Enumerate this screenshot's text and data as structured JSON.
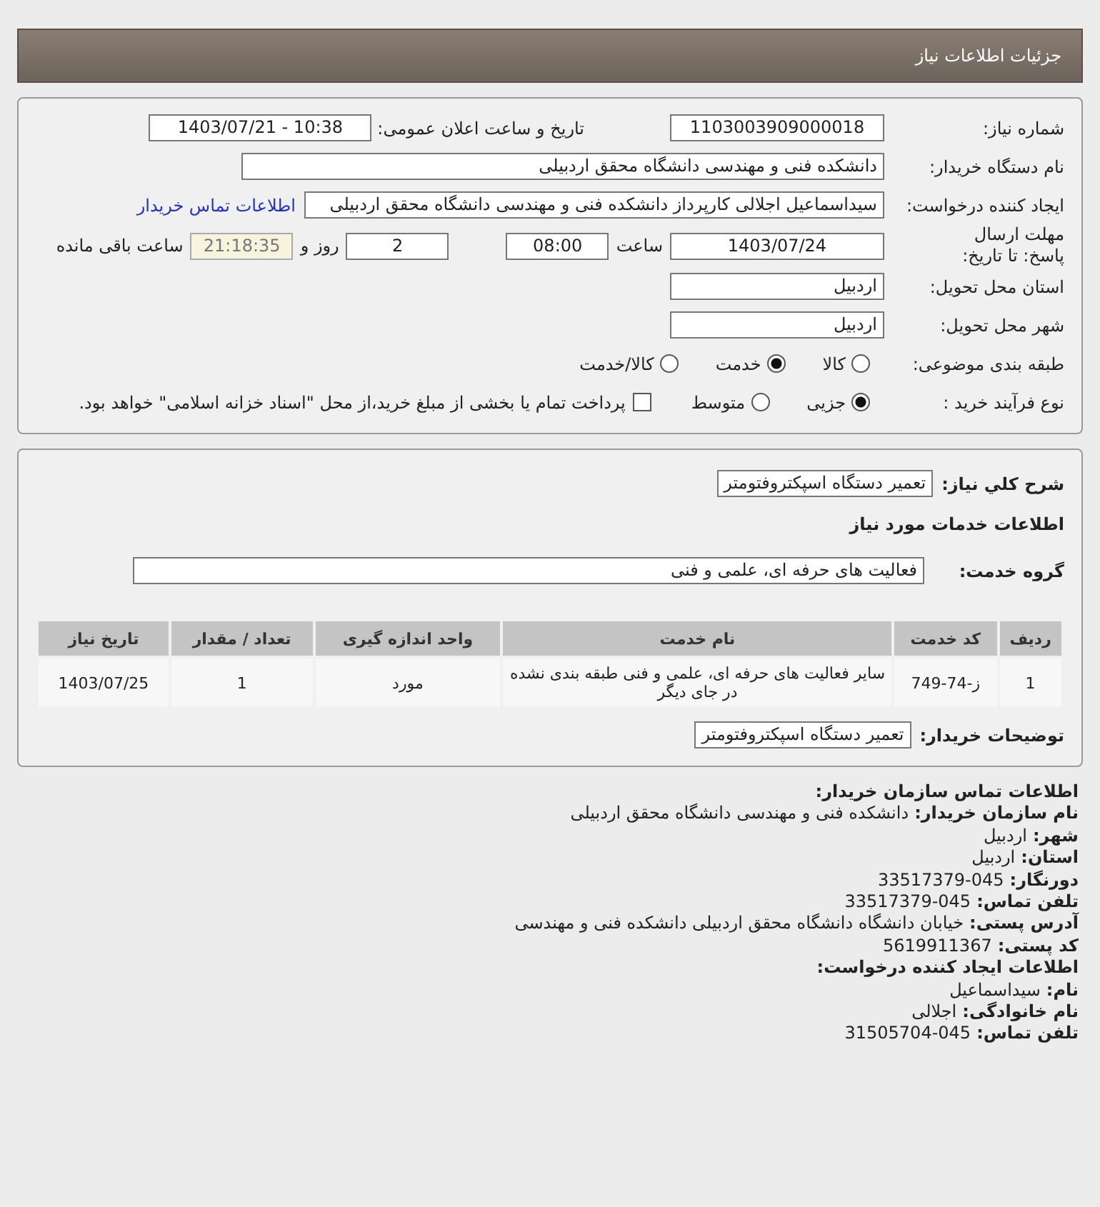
{
  "page": {
    "title": "جزئیات اطلاعات نیاز"
  },
  "details": {
    "need_number": {
      "label": "شماره نیاز:",
      "value": "1103003909000018"
    },
    "announce": {
      "label": "تاریخ و ساعت اعلان عمومی:",
      "value": "1403/07/21 - 10:38"
    },
    "buyer": {
      "label": "نام دستگاه خریدار:",
      "value": "دانشکده فنی و مهندسی دانشگاه محقق اردبیلی"
    },
    "creator": {
      "label": "ایجاد کننده درخواست:",
      "value": "سیداسماعیل اجلالی کارپرداز دانشکده فنی و مهندسی دانشگاه محقق اردبیلی",
      "link": "اطلاعات تماس خریدار"
    },
    "deadline": {
      "label": "مهلت ارسال پاسخ: تا تاریخ:",
      "date": "1403/07/24",
      "time_label": "ساعت",
      "time": "08:00",
      "days": "2",
      "days_label": "روز و",
      "remaining": "21:18:35",
      "remaining_label": "ساعت باقی مانده"
    },
    "province": {
      "label": "استان محل تحویل:",
      "value": "اردبیل"
    },
    "city": {
      "label": "شهر محل تحویل:",
      "value": "اردبیل"
    },
    "category": {
      "label": "طبقه بندی موضوعی:",
      "options": [
        {
          "label": "کالا",
          "selected": false
        },
        {
          "label": "خدمت",
          "selected": true
        },
        {
          "label": "کالا/خدمت",
          "selected": false
        }
      ]
    },
    "process": {
      "label": "نوع فرآیند خرید :",
      "options": [
        {
          "label": "جزیی",
          "selected": true
        },
        {
          "label": "متوسط",
          "selected": false
        }
      ],
      "payment": {
        "checked": false,
        "label": "پرداخت تمام یا بخشی از مبلغ خرید،از محل \"اسناد خزانه اسلامی\" خواهد بود."
      }
    }
  },
  "need": {
    "summary_label": "شرح کلي نیاز:",
    "summary": "تعمیر دستگاه اسپکتروفتومتر",
    "services_heading": "اطلاعات خدمات مورد نیاز",
    "group_label": "گروه خدمت:",
    "group": "فعالیت های حرفه ای، علمی و فنی",
    "table": {
      "columns": [
        "ردیف",
        "کد خدمت",
        "نام خدمت",
        "واحد اندازه گیری",
        "تعداد / مقدار",
        "تاریخ نیاز"
      ],
      "rows": [
        [
          "1",
          "ز-74-749",
          "سایر فعالیت های حرفه ای، علمی و فنی طبقه بندی نشده در جای دیگر",
          "مورد",
          "1",
          "1403/07/25"
        ]
      ]
    },
    "notes_label": "توضیحات خریدار:",
    "notes": "تعمیر دستگاه اسپکتروفتومتر"
  },
  "contact": {
    "heading": "اطلاعات تماس سازمان خریدار:",
    "lines": [
      {
        "label": "نام سازمان خریدار:",
        "value": "دانشکده فنی و مهندسی دانشگاه محقق اردبیلی"
      },
      {
        "label": "شهر:",
        "value": "اردبیل"
      },
      {
        "label": "استان:",
        "value": "اردبیل"
      },
      {
        "label": "دورنگار:",
        "value": "33517379-045"
      },
      {
        "label": "تلفن تماس:",
        "value": "33517379-045"
      },
      {
        "label": "آدرس پستی:",
        "value": "خیابان دانشگاه دانشگاه محقق اردبیلی دانشکده فنی و مهندسی"
      },
      {
        "label": "کد پستی:",
        "value": "5619911367"
      }
    ],
    "creator_heading": "اطلاعات ایجاد کننده درخواست:",
    "creator_lines": [
      {
        "label": "نام:",
        "value": "سیداسماعیل"
      },
      {
        "label": "نام خانوادگی:",
        "value": "اجلالی"
      },
      {
        "label": "تلفن تماس:",
        "value": "31505704-045"
      }
    ]
  }
}
